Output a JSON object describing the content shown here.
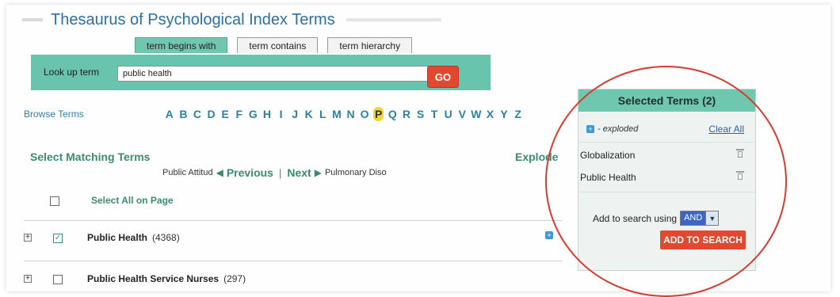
{
  "title": "Thesaurus of Psychological Index Terms",
  "tabs": [
    {
      "label": "term begins with",
      "active": true
    },
    {
      "label": "term contains",
      "active": false
    },
    {
      "label": "term hierarchy",
      "active": false
    }
  ],
  "lookup": {
    "label": "Look up term",
    "value": "public health",
    "go_label": "GO"
  },
  "browse": {
    "label": "Browse Terms",
    "letters": [
      "A",
      "B",
      "C",
      "D",
      "E",
      "F",
      "G",
      "H",
      "I",
      "J",
      "K",
      "L",
      "M",
      "N",
      "O",
      "P",
      "Q",
      "R",
      "S",
      "T",
      "U",
      "V",
      "W",
      "X",
      "Y",
      "Z"
    ],
    "active_letter": "P"
  },
  "matching": {
    "title": "Select Matching Terms",
    "explode_label": "Explode",
    "pager": {
      "prev_term": "Public Attitud",
      "prev_label": "Previous",
      "separator": "|",
      "next_label": "Next",
      "next_term": "Pulmonary Diso"
    },
    "select_all_label": "Select All on Page",
    "terms": [
      {
        "name": "Public Health",
        "count": "(4368)",
        "checked": true
      },
      {
        "name": "Public Health Service Nurses",
        "count": "(297)",
        "checked": false
      }
    ]
  },
  "selected": {
    "header": "Selected Terms (2)",
    "legend": "- exploded",
    "clear_all": "Clear All",
    "terms": [
      "Globalization",
      "Public Health"
    ],
    "add_using_label": "Add to search using",
    "operator": "AND",
    "add_button": "ADD TO SEARCH"
  },
  "colors": {
    "accent_teal": "#68c4ad",
    "go_red": "#e2482f",
    "link_blue": "#2f7fa3",
    "highlight_circle": "#d83a2f"
  }
}
